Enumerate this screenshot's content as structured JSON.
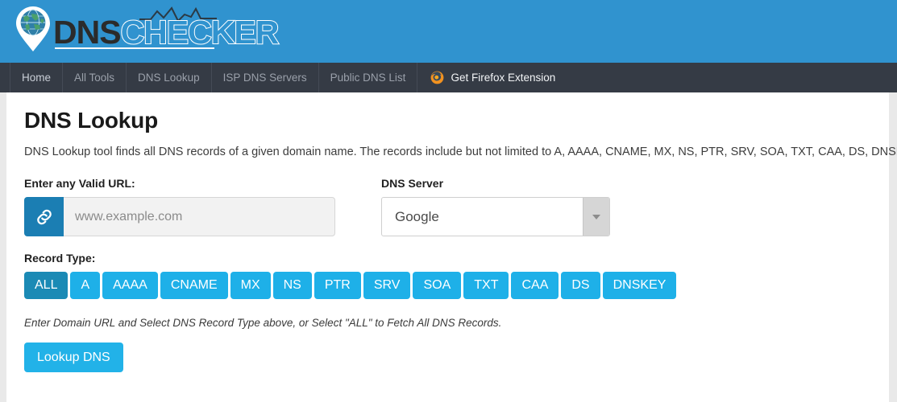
{
  "header": {
    "logo": {
      "icon_name": "globe-map-pin-icon",
      "wave_icon_name": "pulse-waveform-icon",
      "text_dns": "DNS",
      "text_checker": "CHECKER"
    },
    "background_color": "#3093cf"
  },
  "nav": {
    "background_color": "#353b45",
    "items": [
      {
        "label": "Home",
        "active": true
      },
      {
        "label": "All Tools",
        "active": false
      },
      {
        "label": "DNS Lookup",
        "active": false
      },
      {
        "label": "ISP DNS Servers",
        "active": false
      },
      {
        "label": "Public DNS List",
        "active": false
      }
    ],
    "extension": {
      "label": "Get Firefox Extension",
      "icon_name": "firefox-icon"
    }
  },
  "main": {
    "title": "DNS Lookup",
    "description": "DNS Lookup tool finds all DNS records of a given domain name. The records include but not limited to A, AAAA, CNAME, MX, NS, PTR, SRV, SOA, TXT, CAA, DS, DNSKEY.",
    "url_field": {
      "label": "Enter any Valid URL:",
      "placeholder": "www.example.com",
      "value": "",
      "addon_icon_name": "link-chain-icon",
      "addon_color": "#1b7eb3"
    },
    "dns_server": {
      "label": "DNS Server",
      "selected": "Google",
      "arrow_icon_name": "chevron-down-icon"
    },
    "record_type": {
      "label": "Record Type:",
      "active_color": "#1b8ab5",
      "default_color": "#1eb0e8",
      "options": [
        {
          "label": "ALL",
          "active": true
        },
        {
          "label": "A",
          "active": false
        },
        {
          "label": "AAAA",
          "active": false
        },
        {
          "label": "CNAME",
          "active": false
        },
        {
          "label": "MX",
          "active": false
        },
        {
          "label": "NS",
          "active": false
        },
        {
          "label": "PTR",
          "active": false
        },
        {
          "label": "SRV",
          "active": false
        },
        {
          "label": "SOA",
          "active": false
        },
        {
          "label": "TXT",
          "active": false
        },
        {
          "label": "CAA",
          "active": false
        },
        {
          "label": "DS",
          "active": false
        },
        {
          "label": "DNSKEY",
          "active": false
        }
      ]
    },
    "helper_text": "Enter Domain URL and Select DNS Record Type above, or Select \"ALL\" to Fetch All DNS Records.",
    "submit_label": "Lookup DNS",
    "submit_color": "#22b2e8"
  }
}
